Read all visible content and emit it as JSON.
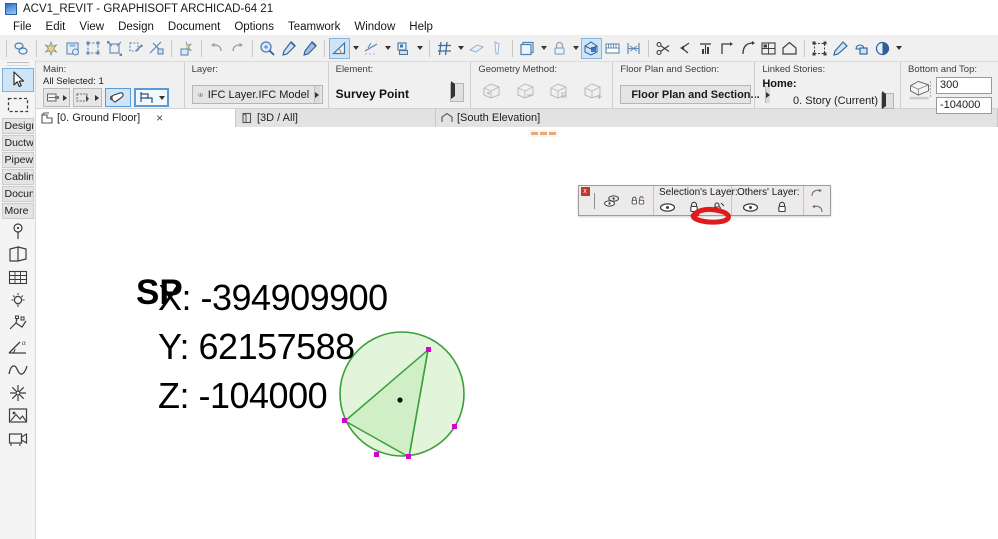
{
  "window": {
    "title": "ACV1_REVIT - GRAPHISOFT ARCHICAD-64 21",
    "logo_icon": "archicad-logo-icon"
  },
  "menubar": {
    "items": [
      {
        "label": "File"
      },
      {
        "label": "Edit"
      },
      {
        "label": "View"
      },
      {
        "label": "Design"
      },
      {
        "label": "Document"
      },
      {
        "label": "Options"
      },
      {
        "label": "Teamwork"
      },
      {
        "label": "Window"
      },
      {
        "label": "Help"
      }
    ]
  },
  "toolbar": {
    "buttons": [
      {
        "name": "teamwork-reserve-icon",
        "active": false
      },
      {
        "name": "new-project-icon",
        "active": false
      },
      {
        "name": "save-project-icon",
        "active": false
      },
      {
        "name": "magic-wand-edit-icon",
        "active": false
      },
      {
        "name": "marquee-stretch-icon",
        "active": false
      },
      {
        "name": "edit-elements-icon",
        "active": false
      },
      {
        "name": "trim-elements-icon",
        "active": false
      },
      {
        "name": "split-element-icon",
        "active": false
      },
      {
        "name": "undo-icon",
        "active": false
      },
      {
        "name": "redo-icon",
        "active": false
      },
      {
        "name": "find-select-icon",
        "active": false
      },
      {
        "name": "parameter-transfer-pick-icon",
        "active": false
      },
      {
        "name": "parameter-transfer-inject-icon",
        "active": false
      },
      {
        "name": "arrow-tool-icon",
        "active": true
      },
      {
        "name": "guide-line-icon",
        "active": false
      },
      {
        "name": "snap-point-icon",
        "active": false
      },
      {
        "name": "grid-snap-icon",
        "active": false
      },
      {
        "name": "measure-icon",
        "active": false
      },
      {
        "name": "align-icon",
        "active": false
      },
      {
        "name": "layer-visibility-icon",
        "active": false
      },
      {
        "name": "lock-icon",
        "active": false
      },
      {
        "name": "3d-cutaway-icon",
        "active": true
      },
      {
        "name": "dimension-icon",
        "active": false
      },
      {
        "name": "element-size-icon",
        "active": false
      },
      {
        "name": "cut-icon",
        "active": false
      },
      {
        "name": "drag-copy-icon",
        "active": false
      },
      {
        "name": "elevate-icon",
        "active": false
      },
      {
        "name": "rotate-copy-icon",
        "active": false
      },
      {
        "name": "mirror-icon",
        "active": false
      },
      {
        "name": "multiply-icon",
        "active": false
      },
      {
        "name": "home-story-icon",
        "active": false
      },
      {
        "name": "group-icon",
        "active": false
      },
      {
        "name": "pen-edit-icon",
        "active": false
      },
      {
        "name": "solid-operations-icon",
        "active": false
      },
      {
        "name": "renovation-filter-icon",
        "active": false
      }
    ]
  },
  "infobox": {
    "main": {
      "title": "Main:",
      "selection_status": "All Selected: 1",
      "buttons": [
        {
          "name": "element-settings-icon"
        },
        {
          "name": "selection-mode-icon"
        },
        {
          "name": "drag-hand-icon"
        },
        {
          "name": "survey-point-element-icon"
        }
      ]
    },
    "layer": {
      "title": "Layer:",
      "value": "IFC Layer.IFC Model",
      "eye_icon": "eye-icon"
    },
    "element": {
      "title": "Element:",
      "value": "Survey Point"
    },
    "geometry": {
      "title": "Geometry Method:",
      "options": [
        "box-method-1-icon",
        "box-method-2-icon",
        "box-method-3-icon",
        "box-method-4-icon"
      ],
      "enabled": false
    },
    "floorplan": {
      "title": "Floor Plan and Section:",
      "value": "Floor Plan and Section...",
      "icon": "floor-plan-section-icon"
    },
    "linked_stories": {
      "title": "Linked Stories:",
      "home_label": "Home:",
      "home_value": "0. Story (Current)"
    },
    "bottom_top": {
      "title": "Bottom and Top:",
      "icon": "bottom-top-icon",
      "top_value": "300",
      "bottom_value": "-104000"
    }
  },
  "tabs": [
    {
      "label": "[0. Ground Floor]",
      "icon": "floor-plan-icon",
      "active": true,
      "closable": true,
      "close_label": "×"
    },
    {
      "label": "[3D / All]",
      "icon": "3d-view-icon",
      "active": false,
      "closable": false
    },
    {
      "label": "[South Elevation]",
      "icon": "elevation-icon",
      "active": false,
      "closable": false
    }
  ],
  "sidebar": {
    "tools_top": [
      {
        "name": "arrow-select-tool",
        "icon": "arrow-cursor-icon",
        "active": true
      },
      {
        "name": "marquee-tool",
        "icon": "marquee-dashed-icon",
        "active": false
      }
    ],
    "groups": [
      {
        "label": "Design",
        "full": "Design"
      },
      {
        "label": "Ductw",
        "full": "Ductwork"
      },
      {
        "label": "Pipew",
        "full": "Pipework"
      },
      {
        "label": "Cablin",
        "full": "Cabling"
      },
      {
        "label": "Docum",
        "full": "Document"
      },
      {
        "label": "More",
        "full": "More"
      }
    ],
    "tools_bottom": [
      {
        "name": "hotspot-tool",
        "icon": "hotspot-icon"
      },
      {
        "name": "door-tool",
        "icon": "door-icon"
      },
      {
        "name": "curtain-wall-tool",
        "icon": "grid-mesh-icon"
      },
      {
        "name": "lamp-tool",
        "icon": "lamp-icon"
      },
      {
        "name": "mep-tool",
        "icon": "mep-branch-icon"
      },
      {
        "name": "angle-dimension-tool",
        "icon": "angle-dimension-icon"
      },
      {
        "name": "spline-tool",
        "icon": "spline-curve-icon"
      },
      {
        "name": "sun-tool",
        "icon": "sun-star-icon"
      },
      {
        "name": "figure-tool",
        "icon": "image-figure-icon"
      },
      {
        "name": "camera-tool",
        "icon": "camera-icon"
      }
    ]
  },
  "palette": {
    "close_label": "x",
    "left_buttons": [
      {
        "name": "show-hide-layers-icon"
      },
      {
        "name": "lock-unlock-layers-icon"
      }
    ],
    "sections": [
      {
        "title": "Selection's Layer:",
        "buttons": [
          {
            "name": "selection-layer-visible-icon"
          },
          {
            "name": "selection-layer-lock-icon"
          },
          {
            "name": "selection-layer-wireframe-icon"
          }
        ]
      },
      {
        "title": "Others' Layer:",
        "buttons": [
          {
            "name": "others-layer-visible-icon"
          },
          {
            "name": "others-layer-lock-icon"
          }
        ]
      }
    ],
    "history_buttons": [
      {
        "name": "layer-redo-icon"
      },
      {
        "name": "layer-undo-icon"
      }
    ]
  },
  "canvas": {
    "survey_point_tag": "SP",
    "coordinates": [
      {
        "label": "X:",
        "value": "-394909900",
        "text": "X: -394909900"
      },
      {
        "label": "Y:",
        "value": "62157588",
        "text": "Y: 62157588"
      },
      {
        "label": "Z:",
        "value": "-104000",
        "text": "Z: -104000"
      }
    ],
    "colors": {
      "element_stroke": "#3aa03a",
      "element_fill": "#d9f3d2",
      "selection_handle": "#d400d4",
      "annotation_red": "#e01b1b",
      "marker_orange": "#f0a870"
    },
    "element_name": "survey-point-element",
    "selection_handle_count": 6
  }
}
